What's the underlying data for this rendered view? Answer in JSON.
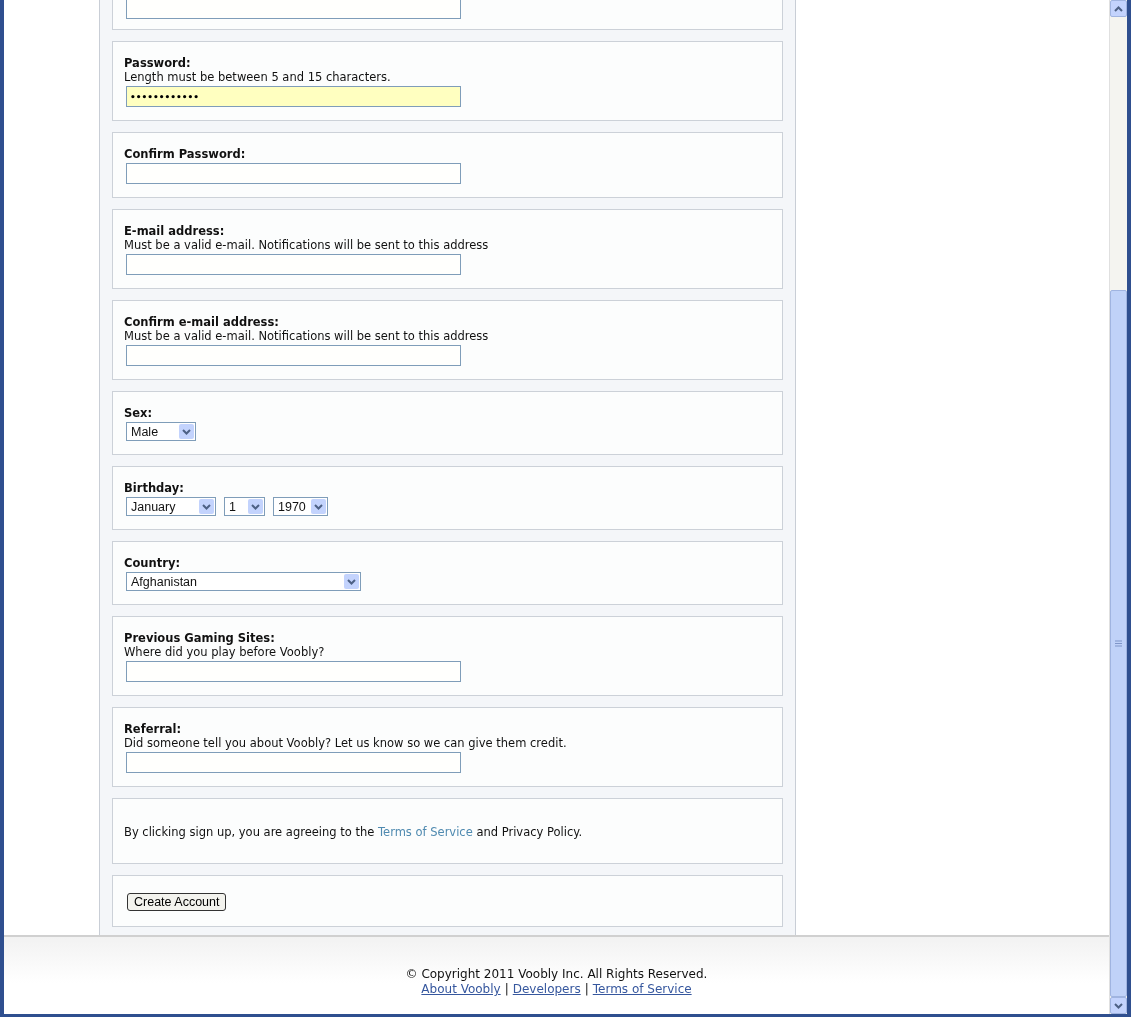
{
  "sections": [
    {
      "kind": "text"
    },
    {
      "kind": "password",
      "label": "Password:",
      "hint": "Length must be between 5 and 15 characters.",
      "value": "••••••••••••",
      "highlighted": true
    },
    {
      "kind": "password",
      "label": "Confirm Password:",
      "highlighted": false
    },
    {
      "kind": "text",
      "label": "E-mail address:",
      "hint": "Must be a valid e-mail. Notifications will be sent to this address"
    },
    {
      "kind": "text",
      "label": "Confirm e-mail address:",
      "hint": "Must be a valid e-mail. Notifications will be sent to this address"
    },
    {
      "kind": "select",
      "label": "Sex:",
      "selects": [
        "Male"
      ]
    },
    {
      "kind": "select",
      "label": "Birthday:",
      "selects": [
        "January",
        "1",
        "1970"
      ]
    },
    {
      "kind": "select",
      "label": "Country:",
      "selects": [
        "Afghanistan"
      ]
    },
    {
      "kind": "text",
      "label": "Previous Gaming Sites:",
      "hint": "Where did you play before Voobly?"
    },
    {
      "kind": "text",
      "label": "Referral:",
      "hint": "Did someone tell you about Voobly? Let us know so we can give them credit."
    },
    {
      "kind": "notice",
      "before": "By clicking sign up, you are agreeing to the ",
      "link": "Terms of Service",
      "after": " and Privacy Policy."
    },
    {
      "kind": "button",
      "label": "Create Account"
    }
  ],
  "footer": {
    "copyright": "© Copyright 2011 Voobly Inc. All Rights Reserved.",
    "links": [
      "About Voobly",
      "Developers",
      "Terms of Service"
    ],
    "separator": "|"
  }
}
